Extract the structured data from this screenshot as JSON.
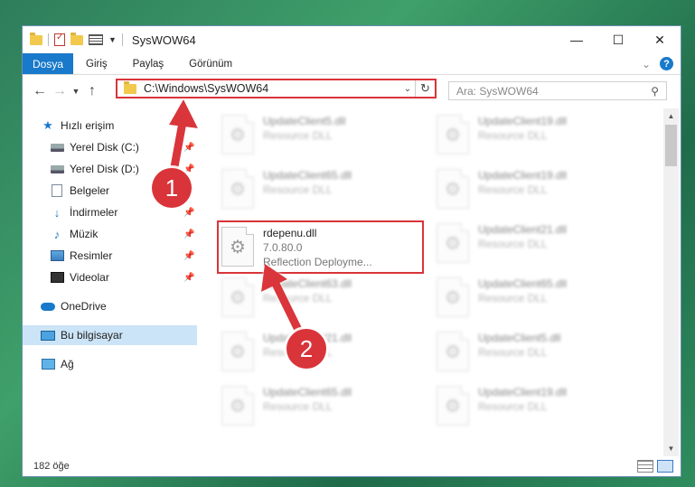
{
  "window": {
    "title": "SysWOW64",
    "controls": {
      "minimize": "—",
      "maximize": "☐",
      "close": "✕"
    }
  },
  "ribbon": {
    "tabs": [
      "Dosya",
      "Giriş",
      "Paylaş",
      "Görünüm"
    ],
    "collapse_icon": "chevron-down-icon",
    "help_label": "?"
  },
  "nav": {
    "address_path": "C:\\Windows\\SysWOW64",
    "search_placeholder": "Ara: SysWOW64"
  },
  "sidebar": {
    "items": [
      {
        "label": "Hızlı erişim",
        "icon": "star-icon",
        "pinned": false,
        "selected": false
      },
      {
        "label": "Yerel Disk (C:)",
        "icon": "drive-icon",
        "pinned": true,
        "selected": false
      },
      {
        "label": "Yerel Disk (D:)",
        "icon": "drive-icon",
        "pinned": true,
        "selected": false
      },
      {
        "label": "Belgeler",
        "icon": "documents-icon",
        "pinned": true,
        "selected": false
      },
      {
        "label": "İndirmeler",
        "icon": "downloads-icon",
        "pinned": true,
        "selected": false
      },
      {
        "label": "Müzik",
        "icon": "music-icon",
        "pinned": true,
        "selected": false
      },
      {
        "label": "Resimler",
        "icon": "pictures-icon",
        "pinned": true,
        "selected": false
      },
      {
        "label": "Videolar",
        "icon": "videos-icon",
        "pinned": true,
        "selected": false
      },
      {
        "label": "OneDrive",
        "icon": "cloud-icon",
        "pinned": false,
        "selected": false
      },
      {
        "label": "Bu bilgisayar",
        "icon": "computer-icon",
        "pinned": false,
        "selected": true
      },
      {
        "label": "Ağ",
        "icon": "network-icon",
        "pinned": false,
        "selected": false
      }
    ]
  },
  "files": [
    {
      "name": "UpdateClient5.dll",
      "sub": "Resource DLL",
      "blurred": true
    },
    {
      "name": "UpdateClient19.dll",
      "sub": "Resource DLL",
      "blurred": true
    },
    {
      "name": "UpdateClient65.dll",
      "sub": "Resource DLL",
      "blurred": true
    },
    {
      "name": "UpdateClient19.dll",
      "sub": "Resource DLL",
      "blurred": true
    },
    {
      "name": "rdepenu.dll",
      "version": "7.0.80.0",
      "sub": "Reflection Deployme...",
      "blurred": false
    },
    {
      "name": "UpdateClient21.dll",
      "sub": "Resource DLL",
      "blurred": true
    },
    {
      "name": "UpdateClient63.dll",
      "sub": "Resource DLL",
      "blurred": true
    },
    {
      "name": "UpdateClient65.dll",
      "sub": "Resource DLL",
      "blurred": true
    },
    {
      "name": "UpdateClient21.dll",
      "sub": "Resource DLL",
      "blurred": true
    },
    {
      "name": "UpdateClient5.dll",
      "sub": "Resource DLL",
      "blurred": true
    },
    {
      "name": "UpdateClient65.dll",
      "sub": "Resource DLL",
      "blurred": true
    },
    {
      "name": "UpdateClient19.dll",
      "sub": "Resource DLL",
      "blurred": true
    }
  ],
  "status": {
    "item_count": "182 öğe"
  },
  "annotations": {
    "step1": "1",
    "step2": "2",
    "color": "#d9343a"
  }
}
